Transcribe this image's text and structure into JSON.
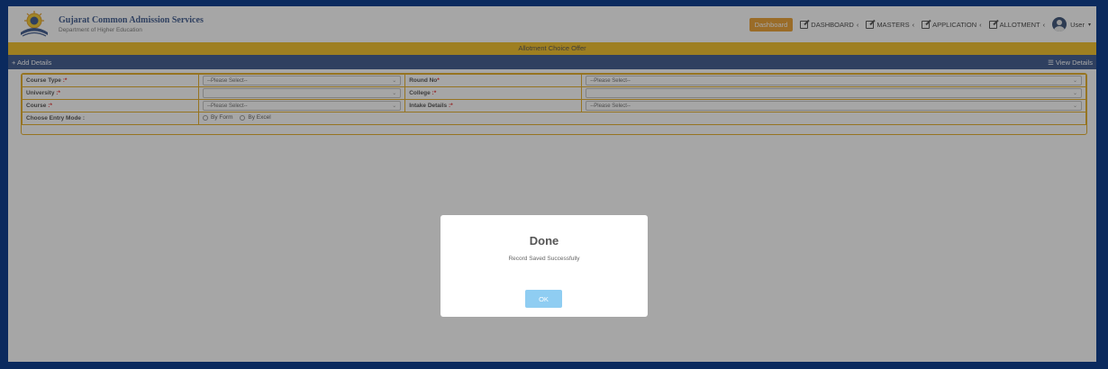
{
  "header": {
    "title": "Gujarat Common Admission Services",
    "subtitle": "Department of Higher Education",
    "logo_icon": "gcas-logo-icon"
  },
  "nav": {
    "badge": "Dashboard",
    "items": [
      {
        "label": "DASHBOARD",
        "icon": "edit-icon"
      },
      {
        "label": "MASTERS",
        "icon": "edit-icon"
      },
      {
        "label": "APPLICATION",
        "icon": "edit-icon"
      },
      {
        "label": "ALLOTMENT",
        "icon": "edit-icon"
      }
    ],
    "chevron": "‹",
    "user_label": "User",
    "user_caret": "▾"
  },
  "page": {
    "title": "Allotment Choice Offer",
    "add_label": "+ Add Details",
    "view_label": "☰ View Details"
  },
  "form": {
    "course_type_label": "Course Type",
    "round_no_label": "Round No",
    "university_label": "University",
    "college_label": "College",
    "course_label": "Course",
    "intake_label": "Intake Details",
    "entry_mode_label": "Choose Entry Mode :",
    "required_mark": ":*",
    "required_mark_round": "*",
    "please_select": "--Please Select--",
    "radio_form": "By Form",
    "radio_excel": "By Excel"
  },
  "modal": {
    "title": "Done",
    "message": "Record Saved Successfully",
    "ok_label": "OK"
  },
  "colors": {
    "brand_navy": "#1c3d7a",
    "title_strip": "#f0b400",
    "badge_orange": "#e8900f",
    "ok_button": "#8fcdf2"
  }
}
